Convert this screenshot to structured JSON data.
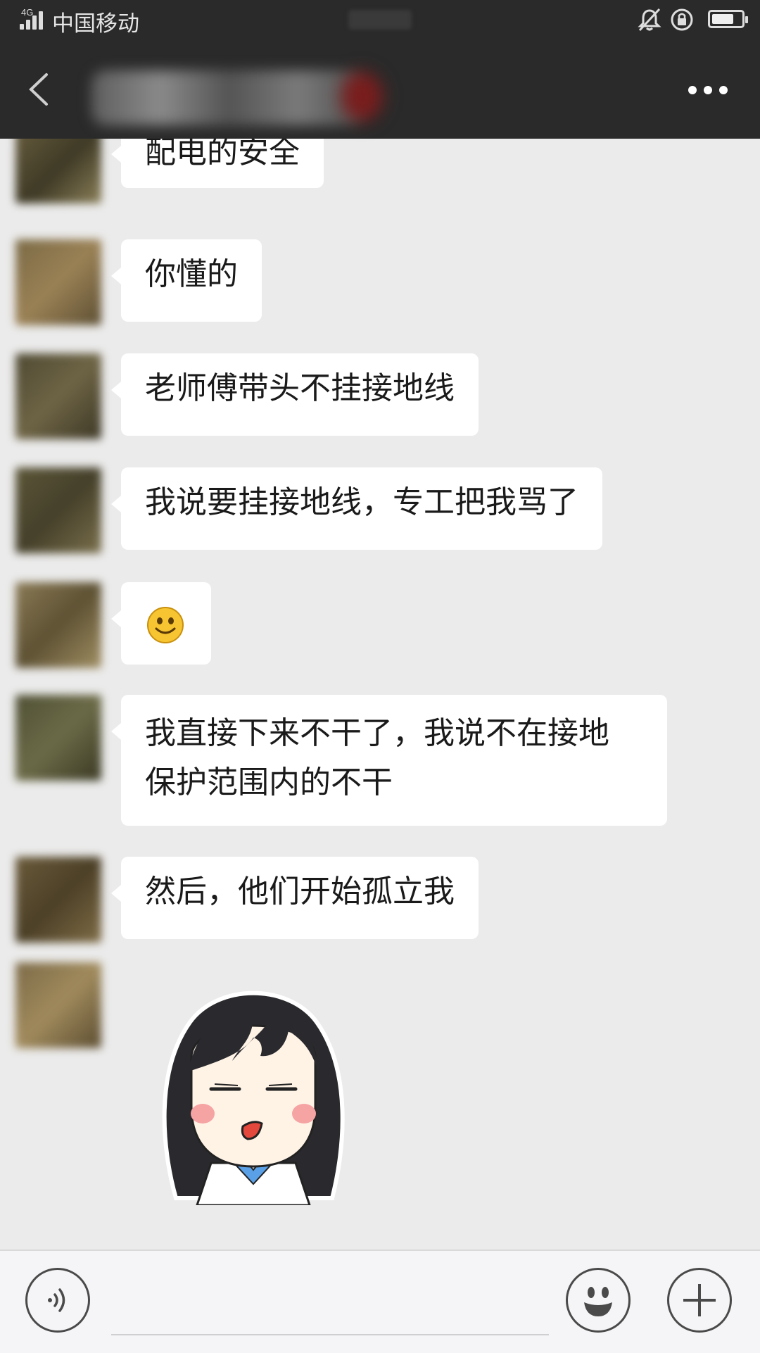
{
  "status_bar": {
    "network": "4G",
    "carrier": "中国移动"
  },
  "header": {
    "back_icon": "chevron-left-icon",
    "more_icon": "more-dots-icon"
  },
  "messages": [
    {
      "type": "text",
      "text": "配电的安全"
    },
    {
      "type": "text",
      "text": "你懂的"
    },
    {
      "type": "text",
      "text": "老师傅带头不挂接地线"
    },
    {
      "type": "text",
      "text": "我说要挂接地线，专工把我骂了"
    },
    {
      "type": "emoji",
      "icon": "smile-emoji-icon"
    },
    {
      "type": "text",
      "lines": [
        "我直接下来不干了，我说不在接地",
        "保护范围内的不干"
      ]
    },
    {
      "type": "text",
      "text": "然后，他们开始孤立我"
    },
    {
      "type": "sticker",
      "icon": "girl-sticker-icon"
    }
  ],
  "input_bar": {
    "voice_icon": "voice-icon",
    "emoji_icon": "emoji-icon",
    "plus_icon": "plus-icon"
  },
  "colors": {
    "header_bg": "#2a2a2a",
    "chat_bg": "#ebebeb",
    "bubble_bg": "#ffffff",
    "input_bg": "#f5f5f7"
  }
}
